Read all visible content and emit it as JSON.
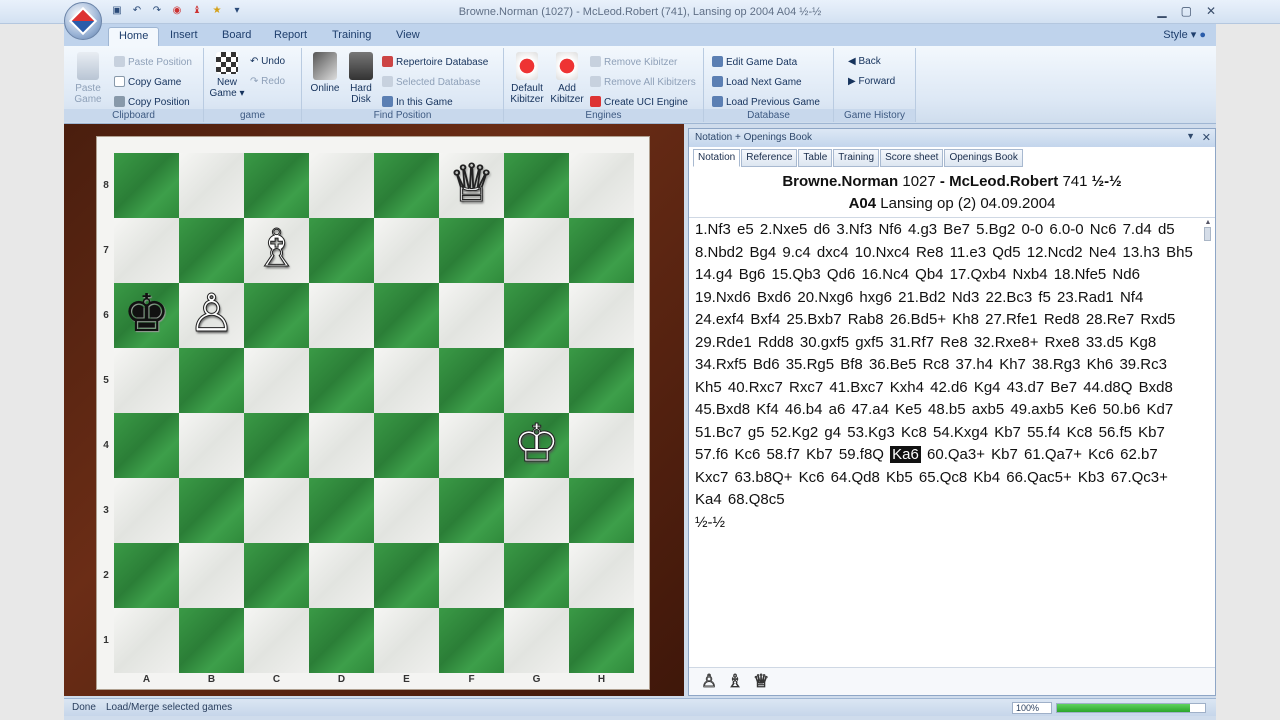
{
  "window": {
    "title": "Browne.Norman (1027) - McLeod.Robert (741), Lansing op 2004  A04  ½-½"
  },
  "ribbon_tabs": [
    "Home",
    "Insert",
    "Board",
    "Report",
    "Training",
    "View"
  ],
  "style_menu": "Style",
  "ribbon": {
    "clipboard": {
      "paste_label": "Paste Game",
      "paste_position": "Paste Position",
      "copy_game": "Copy Game",
      "copy_position": "Copy Position",
      "group": "Clipboard"
    },
    "game": {
      "new_game": "New Game",
      "undo": "Undo",
      "redo": "Redo",
      "group": "game"
    },
    "find_position": {
      "online": "Online",
      "hard_disk": "Hard Disk",
      "repertoire": "Repertoire Database",
      "selected_db": "Selected Database",
      "in_this_game": "In this Game",
      "group": "Find Position"
    },
    "engines": {
      "default_kibitzer": "Default Kibitzer",
      "add_kibitzer": "Add Kibitzer",
      "remove_kibitzer": "Remove Kibitzer",
      "remove_all": "Remove All Kibitzers",
      "create_uci": "Create UCI Engine",
      "group": "Engines"
    },
    "database": {
      "edit_game_data": "Edit Game Data",
      "load_next": "Load Next Game",
      "load_previous": "Load Previous Game",
      "group": "Database"
    },
    "history": {
      "back": "Back",
      "forward": "Forward",
      "group": "Game History"
    }
  },
  "board": {
    "ranks": [
      "8",
      "7",
      "6",
      "5",
      "4",
      "3",
      "2",
      "1"
    ],
    "files": [
      "A",
      "B",
      "C",
      "D",
      "E",
      "F",
      "G",
      "H"
    ],
    "pieces": [
      {
        "square": "f8",
        "glyph": "♕",
        "color": "white",
        "name": "white-queen-piece"
      },
      {
        "square": "c7",
        "glyph": "♗",
        "color": "white",
        "name": "white-bishop-piece"
      },
      {
        "square": "a6",
        "glyph": "♚",
        "color": "black",
        "name": "black-king-piece"
      },
      {
        "square": "b6",
        "glyph": "♙",
        "color": "white",
        "name": "white-pawn-piece"
      },
      {
        "square": "g4",
        "glyph": "♔",
        "color": "white",
        "name": "white-king-piece"
      }
    ]
  },
  "panel": {
    "title": "Notation + Openings Book",
    "tabs": [
      "Notation",
      "Reference",
      "Table",
      "Training",
      "Score sheet",
      "Openings Book"
    ],
    "header": {
      "white": "Browne.Norman",
      "white_elo": "1027",
      "sep": "-",
      "black": "McLeod.Robert",
      "black_elo": "741",
      "result": "½-½",
      "eco": "A04",
      "event": "Lansing op (2) 04.09.2004"
    },
    "moves_before": "1.Nf3  e5  2.Nxe5  d6  3.Nf3  Nf6  4.g3  Be7  5.Bg2  0-0  6.0-0  Nc6  7.d4  d5  8.Nbd2  Bg4  9.c4  dxc4  10.Nxc4  Re8  11.e3  Qd5  12.Ncd2  Ne4  13.h3  Bh5  14.g4  Bg6  15.Qb3  Qd6  16.Nc4  Qb4  17.Qxb4  Nxb4  18.Nfe5  Nd6  19.Nxd6  Bxd6  20.Nxg6  hxg6  21.Bd2  Nd3  22.Bc3  f5  23.Rad1  Nf4  24.exf4  Bxf4  25.Bxb7  Rab8  26.Bd5+  Kh8  27.Rfe1  Red8  28.Re7  Rxd5  29.Rde1  Rdd8  30.gxf5  gxf5  31.Rf7  Re8  32.Rxe8+  Rxe8  33.d5  Kg8  34.Rxf5  Bd6  35.Rg5  Bf8  36.Be5  Rc8  37.h4  Kh7  38.Rg3  Kh6  39.Rc3  Kh5  40.Rxc7  Rxc7  41.Bxc7  Kxh4  42.d6  Kg4  43.d7  Be7  44.d8Q  Bxd8  45.Bxd8  Kf4  46.b4  a6  47.a4  Ke5  48.b5  axb5  49.axb5  Ke6  50.b6  Kd7  51.Bc7  g5  52.Kg2  g4  53.Kg3  Kc8  54.Kxg4  Kb7  55.f4  Kc8  56.f5  Kb7  57.f6  Kc6  58.f7  Kb7  59.f8Q ",
    "current_move": "Ka6",
    "moves_after": " 60.Qa3+  Kb7  61.Qa7+  Kc6  62.b7  Kxc7  63.b8Q+  Kc6  64.Qd8  Kb5  65.Qc8  Kb4  66.Qac5+  Kb3  67.Qc3+  Ka4  68.Q8c5",
    "result_line": "½-½",
    "material": [
      "♙",
      "♗",
      "♕"
    ]
  },
  "status": {
    "text": "Done",
    "hint": "Load/Merge selected games",
    "zoom": "100%",
    "progress": 0.9
  }
}
